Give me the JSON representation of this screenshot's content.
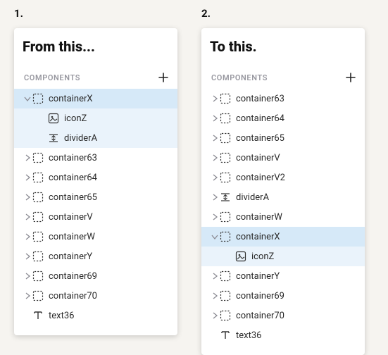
{
  "labels": {
    "num1": "1.",
    "num2": "2.",
    "title1": "From this...",
    "title2": "To this.",
    "section": "COMPONENTS"
  },
  "panel1": {
    "items": [
      {
        "label": "containerX",
        "icon": "container",
        "depth": 0,
        "expanded": true,
        "selected": true,
        "hasChildren": true
      },
      {
        "label": "iconZ",
        "icon": "icon",
        "depth": 1,
        "childSel": true
      },
      {
        "label": "dividerA",
        "icon": "divider",
        "depth": 1,
        "childSel": true
      },
      {
        "label": "container63",
        "icon": "container",
        "depth": 0,
        "hasChildren": true
      },
      {
        "label": "container64",
        "icon": "container",
        "depth": 0,
        "hasChildren": true
      },
      {
        "label": "container65",
        "icon": "container",
        "depth": 0,
        "hasChildren": true
      },
      {
        "label": "containerV",
        "icon": "container",
        "depth": 0,
        "hasChildren": true
      },
      {
        "label": "containerW",
        "icon": "container",
        "depth": 0,
        "hasChildren": true
      },
      {
        "label": "containerY",
        "icon": "container",
        "depth": 0,
        "hasChildren": true
      },
      {
        "label": "container69",
        "icon": "container",
        "depth": 0,
        "hasChildren": true
      },
      {
        "label": "container70",
        "icon": "container",
        "depth": 0,
        "hasChildren": true
      },
      {
        "label": "text36",
        "icon": "text",
        "depth": 0
      }
    ]
  },
  "panel2": {
    "items": [
      {
        "label": "container63",
        "icon": "container",
        "depth": 0,
        "hasChildren": true
      },
      {
        "label": "container64",
        "icon": "container",
        "depth": 0,
        "hasChildren": true
      },
      {
        "label": "container65",
        "icon": "container",
        "depth": 0,
        "hasChildren": true
      },
      {
        "label": "containerV",
        "icon": "container",
        "depth": 0,
        "hasChildren": true
      },
      {
        "label": "containerV2",
        "icon": "container",
        "depth": 0,
        "hasChildren": true
      },
      {
        "label": "dividerA",
        "icon": "divider",
        "depth": 0,
        "hasChildren": true
      },
      {
        "label": "containerW",
        "icon": "container",
        "depth": 0,
        "hasChildren": true
      },
      {
        "label": "containerX",
        "icon": "container",
        "depth": 0,
        "expanded": true,
        "selected": true,
        "hasChildren": true
      },
      {
        "label": "iconZ",
        "icon": "icon",
        "depth": 1,
        "childSel": true
      },
      {
        "label": "containerY",
        "icon": "container",
        "depth": 0,
        "hasChildren": true
      },
      {
        "label": "container69",
        "icon": "container",
        "depth": 0,
        "hasChildren": true
      },
      {
        "label": "container70",
        "icon": "container",
        "depth": 0,
        "hasChildren": true
      },
      {
        "label": "text36",
        "icon": "text",
        "depth": 0
      }
    ]
  }
}
